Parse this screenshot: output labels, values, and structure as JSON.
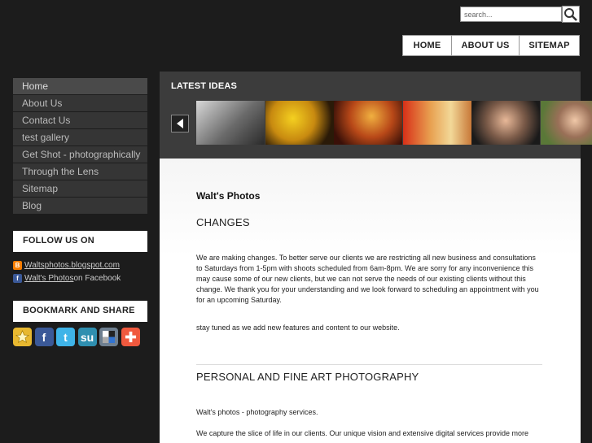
{
  "search": {
    "placeholder": "search..."
  },
  "topnav": [
    "HOME",
    "ABOUT US",
    "SITEMAP"
  ],
  "sidebar": {
    "items": [
      "Home",
      "About Us",
      "Contact Us",
      "test gallery",
      "Get Shot - photographically",
      "Through the Lens",
      "Sitemap",
      "Blog"
    ],
    "follow_title": "FOLLOW US ON",
    "follow_links": [
      {
        "text": "Waltsphotos.blogspot.com",
        "suffix": ""
      },
      {
        "text": "Walt's Photos",
        "suffix": " on Facebook"
      }
    ],
    "bookmark_title": "BOOKMARK AND SHARE",
    "share_icons": [
      "favorites-icon",
      "facebook-icon",
      "twitter-icon",
      "stumbleupon-icon",
      "delicious-icon",
      "addthis-icon"
    ]
  },
  "ideas": {
    "title": "LATEST IDEAS"
  },
  "main": {
    "site_title": "Walt's Photos",
    "heading1": "CHANGES",
    "para1": "We are making changes. To better serve our clients we are restricting all new business and consultations to Saturdays from 1-5pm with shoots scheduled from 6am-8pm. We are sorry for any inconvenience this may cause some of our new clients, but we can not serve the needs of our existing clients without this change. We thank you for your understanding and we look forward to scheduling an appointment with you for an upcoming Saturday.",
    "para2": "stay tuned as we add new features and content to our website.",
    "heading2": "PERSONAL AND FINE ART PHOTOGRAPHY",
    "para3": "Walt's photos - photography services.",
    "para4": "We capture the slice of life in our clients. Our unique vision and extensive digital services provide more"
  },
  "colors": {
    "background": "#1c1c1c",
    "panel": "#3c3c3c",
    "menu_item": "#353535"
  }
}
